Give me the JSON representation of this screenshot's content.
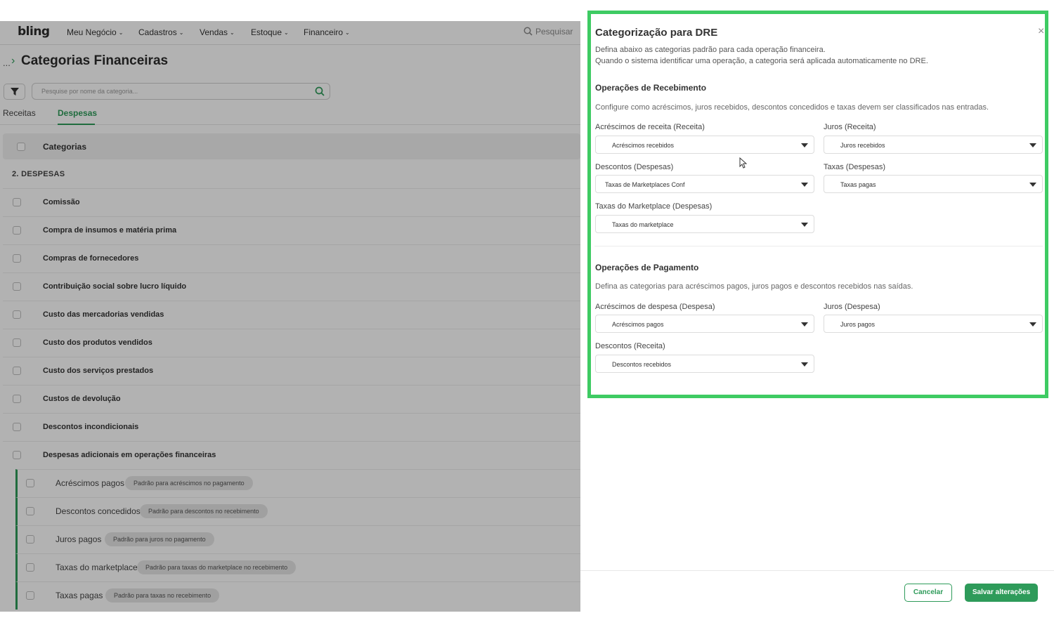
{
  "nav": {
    "logo": "bling",
    "items": [
      {
        "label": "Meu Negócio"
      },
      {
        "label": "Cadastros"
      },
      {
        "label": "Vendas"
      },
      {
        "label": "Estoque"
      },
      {
        "label": "Financeiro"
      }
    ],
    "search_label": "Pesquisar"
  },
  "page": {
    "breadcrumb_ellipsis": "...",
    "title": "Categorias Financeiras",
    "search_placeholder": "Pesquise por nome da categoria...",
    "tabs": [
      {
        "label": "Receitas",
        "active": false
      },
      {
        "label": "Despesas",
        "active": true
      }
    ],
    "table_header": "Categorias",
    "group_label": "2. DESPESAS",
    "rows": [
      "Comissão",
      "Compra de insumos e matéria prima",
      "Compras de fornecedores",
      "Contribuição social sobre lucro líquido",
      "Custo das mercadorias vendidas",
      "Custo dos produtos vendidos",
      "Custo dos serviços prestados",
      "Custos de devolução",
      "Descontos incondicionais",
      "Despesas adicionais em operações financeiras"
    ],
    "sub_rows": [
      {
        "label": "Acréscimos pagos",
        "chip": "Padrão para acréscimos no pagamento"
      },
      {
        "label": "Descontos concedidos",
        "chip": "Padrão para descontos no recebimento"
      },
      {
        "label": "Juros pagos",
        "chip": "Padrão para juros no pagamento"
      },
      {
        "label": "Taxas do marketplace",
        "chip": "Padrão para taxas do marketplace no recebimento"
      },
      {
        "label": "Taxas pagas",
        "chip": "Padrão para taxas no recebimento"
      }
    ]
  },
  "modal": {
    "title": "Categorização para DRE",
    "close_symbol": "×",
    "desc_line1": "Defina abaixo as categorias padrão para cada operação financeira.",
    "desc_line2": "Quando o sistema identificar uma operação, a categoria será aplicada automaticamente no DRE.",
    "receiving": {
      "title": "Operações de Recebimento",
      "desc": "Configure como acréscimos, juros recebidos, descontos concedidos e taxas devem ser classificados nas entradas.",
      "fields": [
        {
          "label": "Acréscimos de receita (Receita)",
          "value": "Acréscimos recebidos"
        },
        {
          "label": "Juros (Receita)",
          "value": "Juros recebidos"
        },
        {
          "label": "Descontos (Despesas)",
          "value": "Taxas de Marketplaces Conf"
        },
        {
          "label": "Taxas (Despesas)",
          "value": "Taxas pagas"
        },
        {
          "label": "Taxas do Marketplace (Despesas)",
          "value": "Taxas do marketplace"
        }
      ]
    },
    "payment": {
      "title": "Operações de Pagamento",
      "desc": "Defina as categorias para acréscimos pagos, juros pagos e descontos recebidos nas saídas.",
      "fields": [
        {
          "label": "Acréscimos de despesa (Despesa)",
          "value": "Acréscimos pagos"
        },
        {
          "label": "Juros (Despesa)",
          "value": "Juros pagos"
        },
        {
          "label": "Descontos (Receita)",
          "value": "Descontos recebidos"
        }
      ]
    },
    "cancel_label": "Cancelar",
    "save_label": "Salvar alterações"
  },
  "colors": {
    "brand_green": "#2e9b5a",
    "highlight_green": "#3ecb63"
  }
}
